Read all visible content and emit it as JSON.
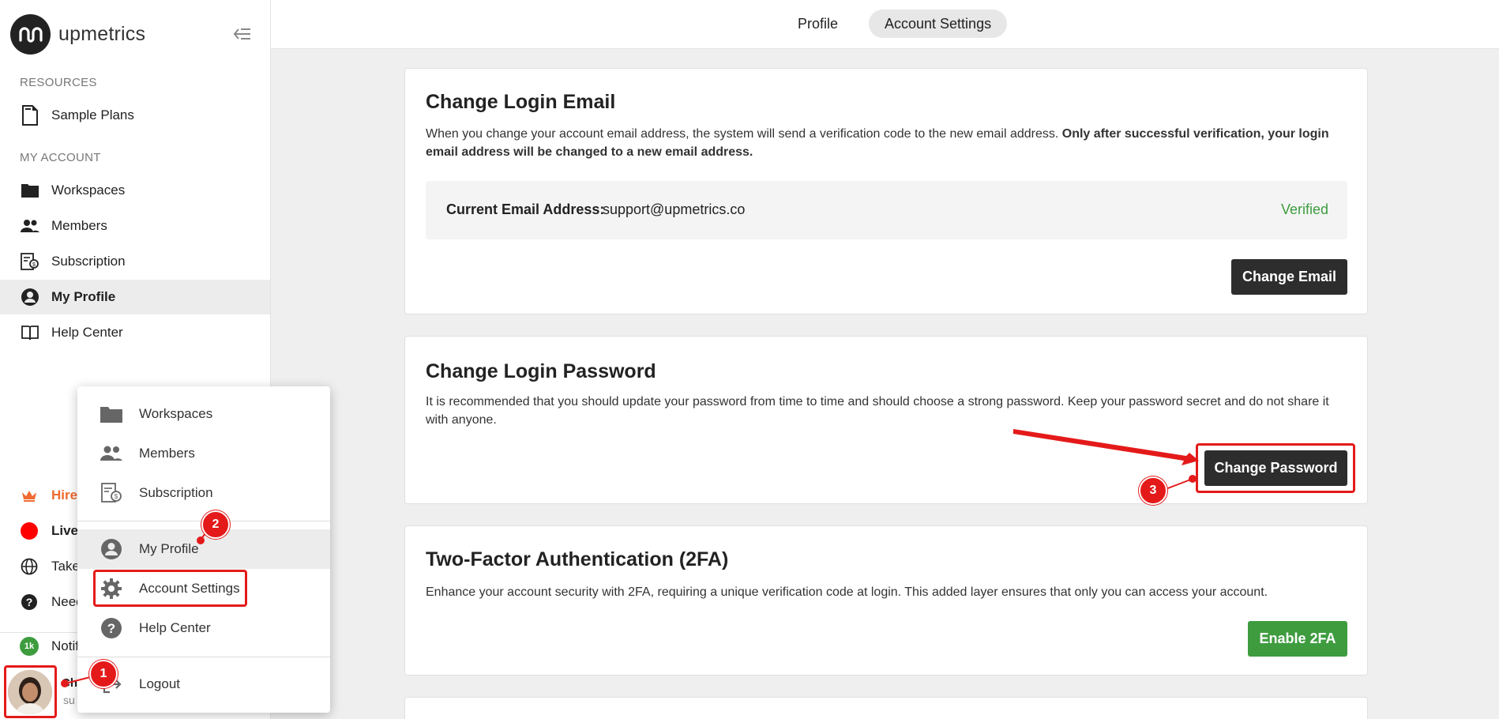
{
  "brand": {
    "name": "upmetrics"
  },
  "sidebar": {
    "resources_label": "RESOURCES",
    "resources": [
      {
        "label": "Sample Plans",
        "icon": "document-icon"
      }
    ],
    "account_label": "MY ACCOUNT",
    "items": [
      {
        "label": "Workspaces",
        "icon": "folder-icon"
      },
      {
        "label": "Members",
        "icon": "people-icon"
      },
      {
        "label": "Subscription",
        "icon": "subscription-icon"
      },
      {
        "label": "My Profile",
        "icon": "account-circle-icon",
        "active": true
      },
      {
        "label": "Help Center",
        "icon": "book-icon"
      }
    ],
    "bottom": [
      {
        "label": "Hire",
        "icon": "crown-icon",
        "color": "#f06a2f"
      },
      {
        "label": "Live",
        "icon": "live-dot-icon"
      },
      {
        "label": "Take",
        "icon": "globe-icon"
      },
      {
        "label": "Need",
        "icon": "help-icon"
      },
      {
        "label": "Notif",
        "badge": "1k"
      }
    ],
    "user_initial_text": "Ch",
    "user_sub_text": "su"
  },
  "tabs": [
    {
      "label": "Profile"
    },
    {
      "label": "Account Settings",
      "active": true
    }
  ],
  "email_card": {
    "title": "Change Login Email",
    "desc": "When you change your account email address, the system will send a verification code to the new email address. ",
    "desc_bold": "Only after successful verification, your login email address will be changed to a new email address.",
    "current_label": "Current Email Address:",
    "current_value": "support@upmetrics.co",
    "status": "Verified",
    "button": "Change Email"
  },
  "password_card": {
    "title": "Change Login Password",
    "desc": "It is recommended that you should update your password from time to time and should choose a strong password. Keep your password secret and do not share it with anyone.",
    "button": "Change Password"
  },
  "twofa_card": {
    "title": "Two-Factor Authentication (2FA)",
    "desc": "Enhance your account security with 2FA, requiring a unique verification code at login. This added layer ensures that only you can access your account.",
    "button": "Enable 2FA"
  },
  "dropdown": {
    "items": [
      {
        "label": "Workspaces",
        "icon": "folder-icon"
      },
      {
        "label": "Members",
        "icon": "people-icon"
      },
      {
        "label": "Subscription",
        "icon": "subscription-icon"
      },
      {
        "label": "My Profile",
        "icon": "account-circle-icon"
      },
      {
        "label": "Account Settings",
        "icon": "gear-icon"
      },
      {
        "label": "Help Center",
        "icon": "help-icon"
      },
      {
        "label": "Logout",
        "icon": "logout-icon"
      }
    ]
  },
  "annotations": {
    "step1": "1",
    "step2": "2",
    "step3": "3",
    "color": "#e41a1a"
  },
  "colors": {
    "accent_dark": "#2d2d2d",
    "verified": "#3e9c3f",
    "enable_2fa": "#3e9c3f",
    "hire": "#f06a2f",
    "live": "#ff0000"
  }
}
